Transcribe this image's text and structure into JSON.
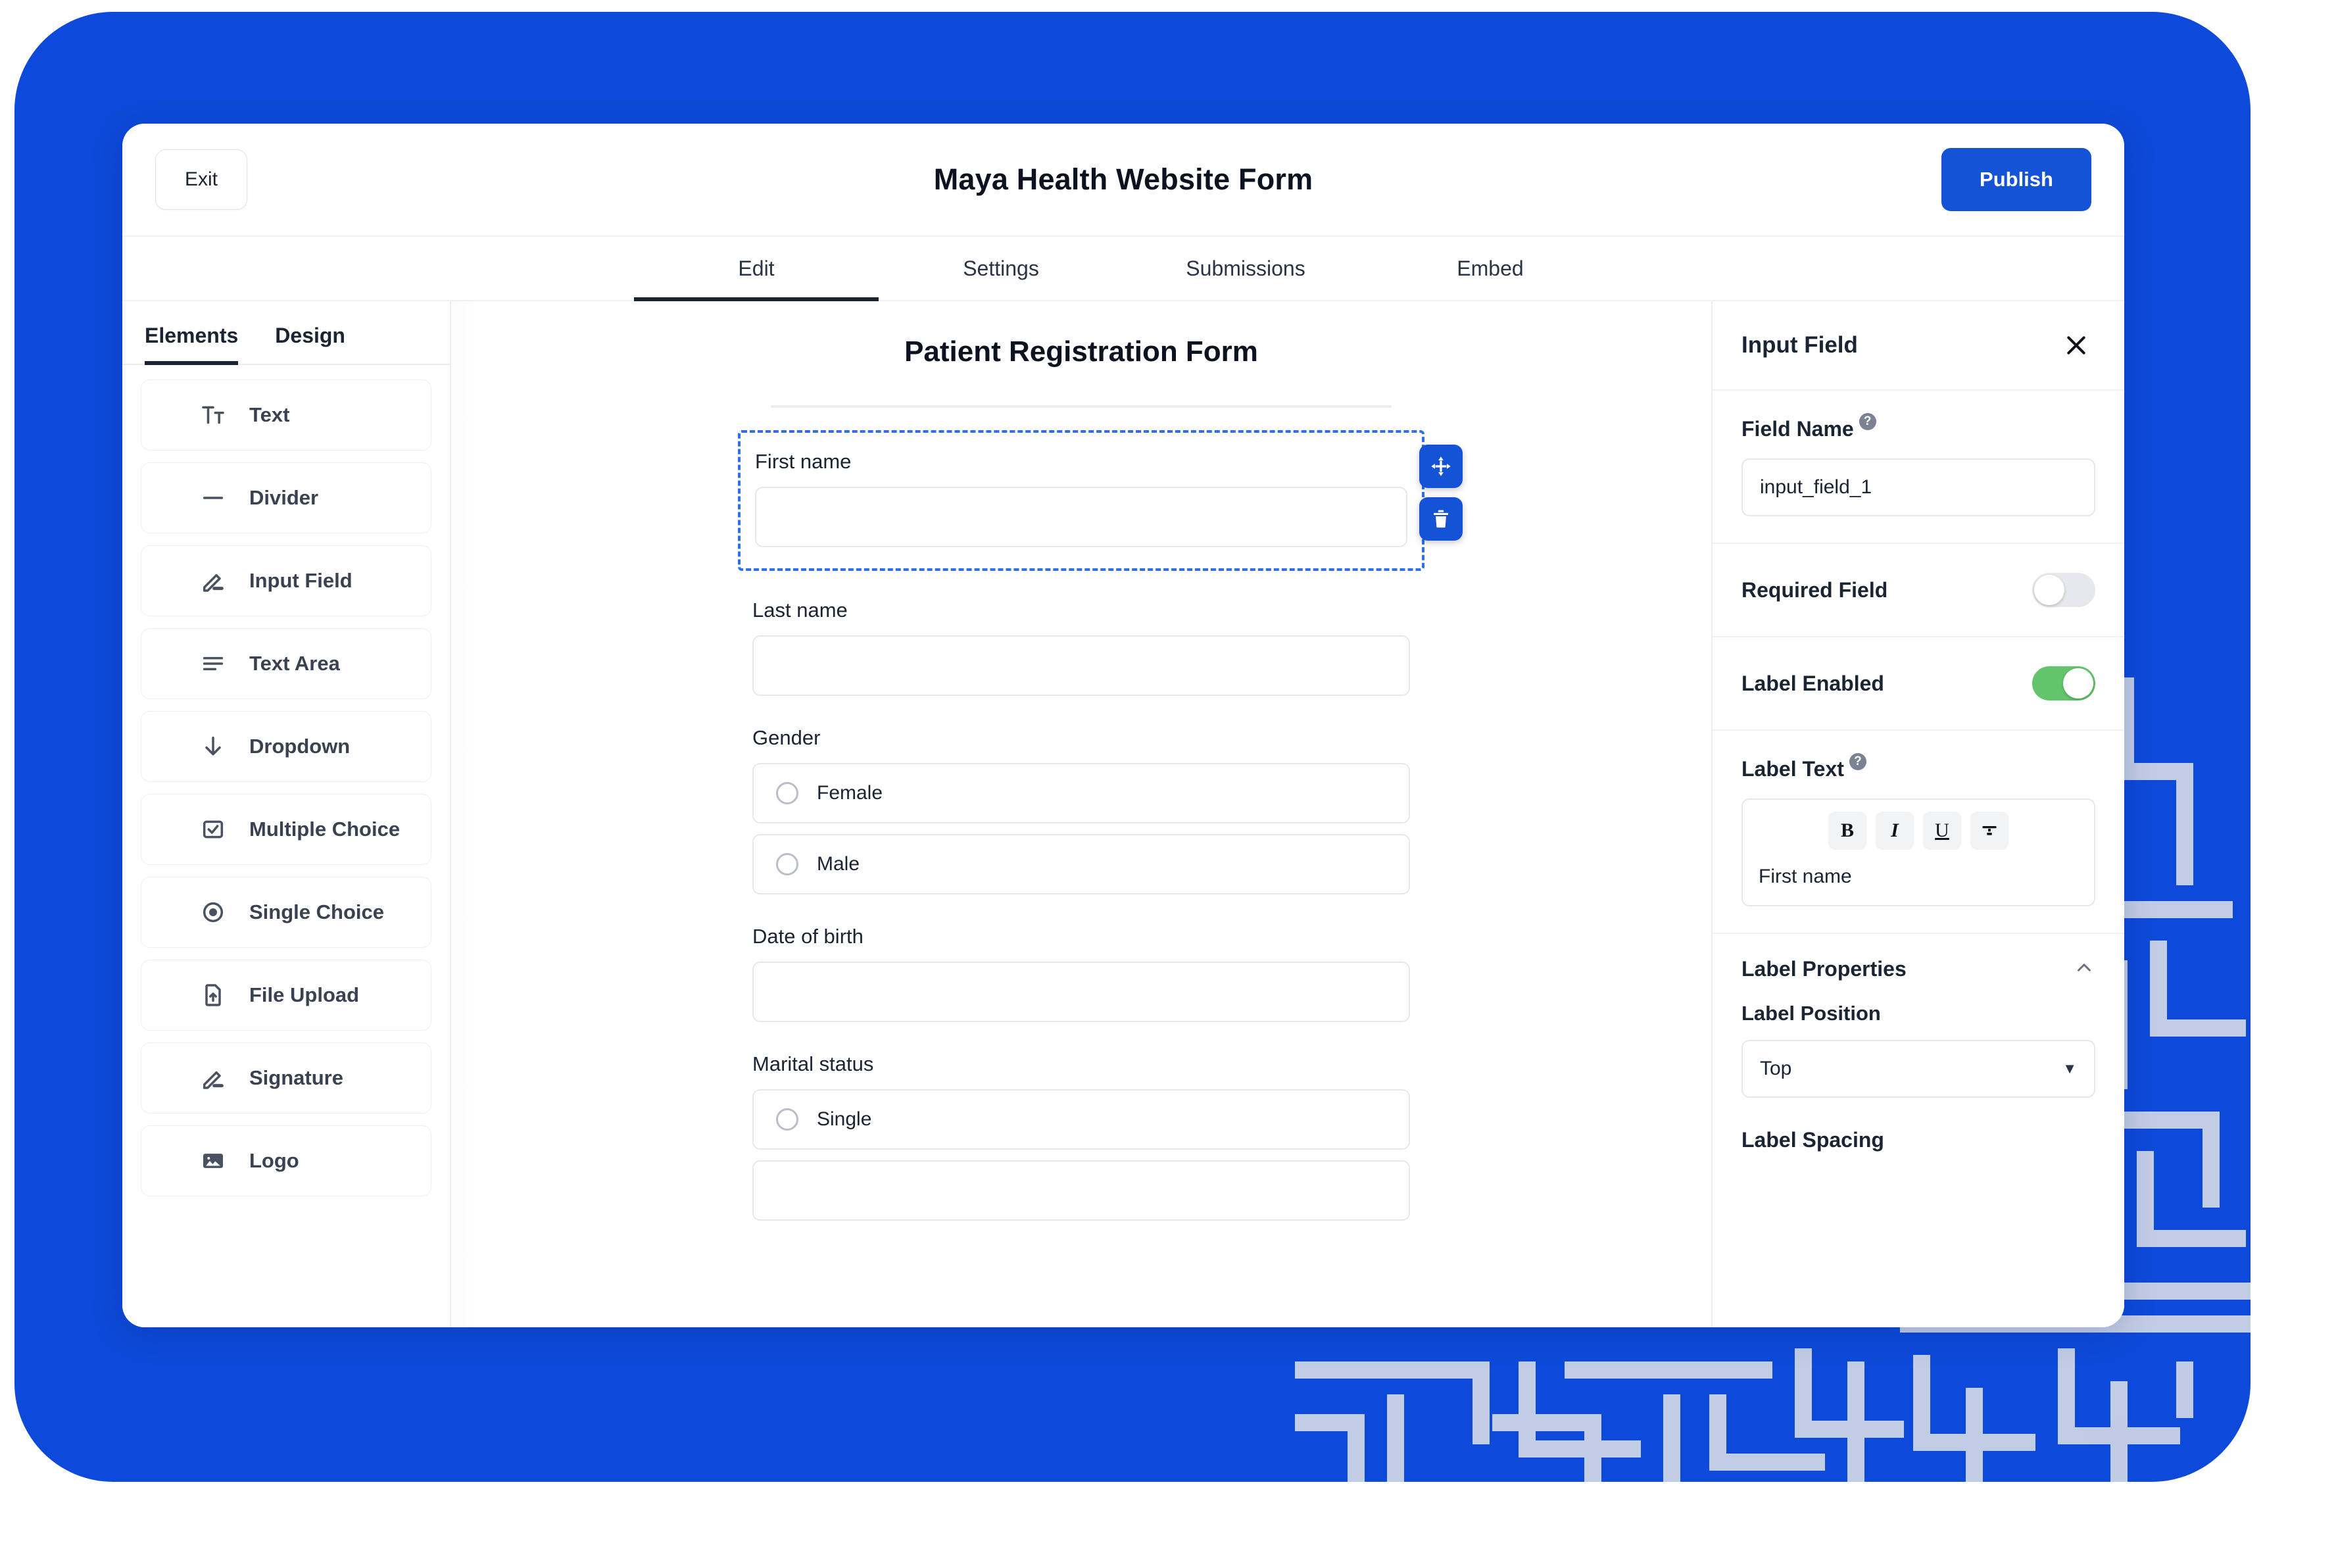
{
  "theme": {
    "brand_blue": "#0d4ad9",
    "accent_blue": "#1553d6",
    "toggle_on_green": "#62c46b",
    "selection_blue": "#2f6fe8"
  },
  "header": {
    "exit_label": "Exit",
    "title": "Maya Health Website Form",
    "publish_label": "Publish"
  },
  "tabs": [
    {
      "label": "Edit",
      "active": true
    },
    {
      "label": "Settings",
      "active": false
    },
    {
      "label": "Submissions",
      "active": false
    },
    {
      "label": "Embed",
      "active": false
    }
  ],
  "left_panel": {
    "tabs": [
      {
        "label": "Elements",
        "active": true
      },
      {
        "label": "Design",
        "active": false
      }
    ],
    "items": [
      {
        "label": "Text",
        "icon": "text-format-icon"
      },
      {
        "label": "Divider",
        "icon": "divider-icon"
      },
      {
        "label": "Input Field",
        "icon": "pencil-icon"
      },
      {
        "label": "Text Area",
        "icon": "text-lines-icon"
      },
      {
        "label": "Dropdown",
        "icon": "arrow-down-icon"
      },
      {
        "label": "Multiple Choice",
        "icon": "checkbox-icon"
      },
      {
        "label": "Single Choice",
        "icon": "radio-icon"
      },
      {
        "label": "File Upload",
        "icon": "file-upload-icon"
      },
      {
        "label": "Signature",
        "icon": "pencil-icon"
      },
      {
        "label": "Logo",
        "icon": "image-icon"
      }
    ]
  },
  "canvas": {
    "form_title": "Patient Registration Form",
    "fields": [
      {
        "type": "input",
        "label": "First name",
        "value": "",
        "selected": true,
        "tools": [
          {
            "name": "move-handle",
            "icon": "move-arrows-icon"
          },
          {
            "name": "delete-field-button",
            "icon": "trash-icon"
          }
        ]
      },
      {
        "type": "input",
        "label": "Last name",
        "value": "",
        "selected": false
      },
      {
        "type": "radio-group",
        "label": "Gender",
        "options": [
          "Female",
          "Male"
        ],
        "selected": false
      },
      {
        "type": "input",
        "label": "Date of birth",
        "value": "",
        "selected": false
      },
      {
        "type": "radio-group",
        "label": "Marital status",
        "options": [
          "Single"
        ],
        "selected": false
      }
    ]
  },
  "right_panel": {
    "title": "Input Field",
    "close_icon": "close-icon",
    "field_name": {
      "label": "Field Name",
      "help": "?",
      "value": "input_field_1"
    },
    "required_field": {
      "label": "Required Field",
      "enabled": false
    },
    "label_enabled": {
      "label": "Label Enabled",
      "enabled": true
    },
    "label_text": {
      "label": "Label Text",
      "help": "?",
      "toolbar": [
        {
          "name": "bold-button",
          "glyph": "B"
        },
        {
          "name": "italic-button",
          "glyph": "I"
        },
        {
          "name": "underline-button",
          "glyph": "U"
        },
        {
          "name": "strikethrough-button",
          "glyph": "T̶"
        }
      ],
      "value": "First name"
    },
    "label_properties": {
      "title": "Label Properties",
      "chevron": "chevron-up-icon",
      "position": {
        "label": "Label Position",
        "value": "Top"
      },
      "spacing": {
        "label": "Label Spacing"
      }
    }
  }
}
